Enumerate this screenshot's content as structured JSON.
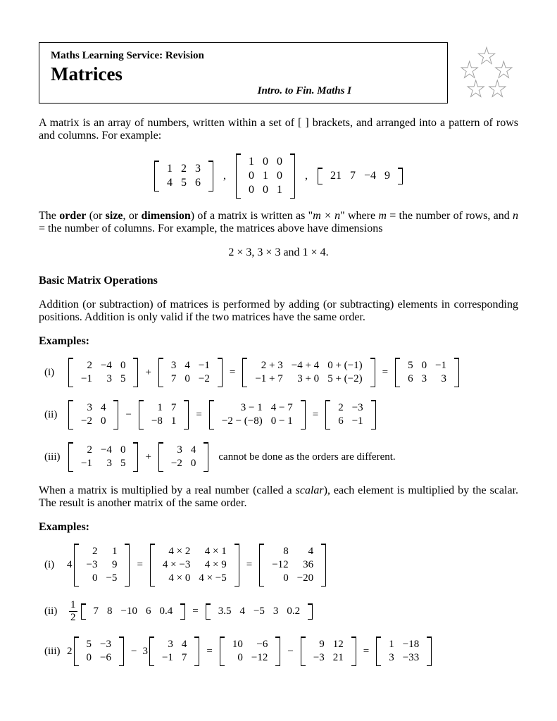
{
  "header": {
    "pretitle": "Maths Learning Service: Revision",
    "title": "Matrices",
    "subtitle": "Intro. to Fin. Maths I"
  },
  "intro": "A matrix is an array of numbers, written within a set of [  ] brackets, and arranged into a pattern of rows and columns. For example:",
  "intro_matrices": {
    "m1": [
      [
        "1",
        "2",
        "3"
      ],
      [
        "4",
        "5",
        "6"
      ]
    ],
    "m2": [
      [
        "1",
        "0",
        "0"
      ],
      [
        "0",
        "1",
        "0"
      ],
      [
        "0",
        "0",
        "1"
      ]
    ],
    "m3": [
      [
        "21",
        "7",
        "−4",
        "9"
      ]
    ]
  },
  "order_text_pre": "The ",
  "order_bold1": "order",
  "order_mid1": " (or ",
  "order_bold2": "size",
  "order_mid2": ", or ",
  "order_bold3": "dimension",
  "order_text_post": ") of a matrix is written as \"",
  "order_mxn": "m × n",
  "order_text_post2": "\" where ",
  "order_m": "m",
  "order_text_post3": " = the number of rows, and ",
  "order_n": "n",
  "order_text_post4": " = the number of columns. For example, the matrices above have dimensions",
  "dimensions_line": "2 × 3,    3 × 3    and    1 × 4.",
  "section1": "Basic Matrix Operations",
  "addition_text": "Addition (or subtraction) of matrices is performed by adding (or subtracting) elements in corresponding positions. Addition is only valid if the two matrices have the same order.",
  "examples_label": "Examples:",
  "ex1": {
    "label_i": "(i)",
    "a": [
      [
        "2",
        "−4",
        "0"
      ],
      [
        "−1",
        "3",
        "5"
      ]
    ],
    "b": [
      [
        "3",
        "4",
        "−1"
      ],
      [
        "7",
        "0",
        "−2"
      ]
    ],
    "step": [
      [
        "2 + 3",
        "−4 + 4",
        "0 + (−1)"
      ],
      [
        "−1 + 7",
        "3 + 0",
        "5 + (−2)"
      ]
    ],
    "result": [
      [
        "5",
        "0",
        "−1"
      ],
      [
        "6",
        "3",
        "3"
      ]
    ],
    "label_ii": "(ii)",
    "c": [
      [
        "3",
        "4"
      ],
      [
        "−2",
        "0"
      ]
    ],
    "d": [
      [
        "1",
        "7"
      ],
      [
        "−8",
        "1"
      ]
    ],
    "step2": [
      [
        "3 − 1",
        "4 − 7"
      ],
      [
        "−2 − (−8)",
        "0 − 1"
      ]
    ],
    "result2": [
      [
        "2",
        "−3"
      ],
      [
        "6",
        "−1"
      ]
    ],
    "label_iii": "(iii)",
    "e": [
      [
        "2",
        "−4",
        "0"
      ],
      [
        "−1",
        "3",
        "5"
      ]
    ],
    "f": [
      [
        "3",
        "4"
      ],
      [
        "−2",
        "0"
      ]
    ],
    "cannot": "cannot be done as the orders are different."
  },
  "scalar_text_pre": "When a matrix is multiplied by a real number (called a ",
  "scalar_italic": "scalar",
  "scalar_text_post": "), each element is multiplied by the scalar. The result is another matrix of the same order.",
  "ex2": {
    "label_i": "(i)",
    "scal1": "4",
    "a": [
      [
        "2",
        "1"
      ],
      [
        "−3",
        "9"
      ],
      [
        "0",
        "−5"
      ]
    ],
    "step1": [
      [
        "4 × 2",
        "4 × 1"
      ],
      [
        "4 × −3",
        "4 × 9"
      ],
      [
        "4 × 0",
        "4 × −5"
      ]
    ],
    "result1": [
      [
        "8",
        "4"
      ],
      [
        "−12",
        "36"
      ],
      [
        "0",
        "−20"
      ]
    ],
    "label_ii": "(ii)",
    "frac_num": "1",
    "frac_den": "2",
    "b": [
      [
        "7",
        "8",
        "−10",
        "6",
        "0.4"
      ]
    ],
    "result2": [
      [
        "3.5",
        "4",
        "−5",
        "3",
        "0.2"
      ]
    ],
    "label_iii": "(iii)",
    "scal3a": "2",
    "c": [
      [
        "5",
        "−3"
      ],
      [
        "0",
        "−6"
      ]
    ],
    "scal3b": "3",
    "d": [
      [
        "3",
        "4"
      ],
      [
        "−1",
        "7"
      ]
    ],
    "step3a": [
      [
        "10",
        "−6"
      ],
      [
        "0",
        "−12"
      ]
    ],
    "step3b": [
      [
        "9",
        "12"
      ],
      [
        "−3",
        "21"
      ]
    ],
    "result3": [
      [
        "1",
        "−18"
      ],
      [
        "3",
        "−33"
      ]
    ]
  }
}
